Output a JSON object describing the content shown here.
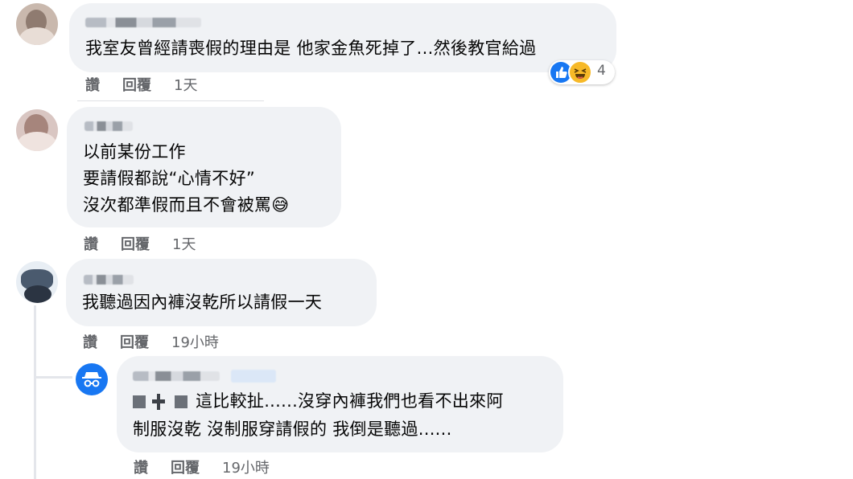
{
  "comments": [
    {
      "text": "我室友曾經請喪假的理由是 他家金魚死掉了...然後教官給過",
      "actions": {
        "like": "讚",
        "reply": "回覆",
        "time": "1天"
      },
      "reaction_count": "4"
    },
    {
      "lines": [
        "以前某份工作",
        "要請假都說“心情不好”",
        "沒次都準假而且不會被罵😅"
      ],
      "actions": {
        "like": "讚",
        "reply": "回覆",
        "time": "1天"
      }
    },
    {
      "text": "我聽過因內褲沒乾所以請假一天",
      "actions": {
        "like": "讚",
        "reply": "回覆",
        "time": "19小時"
      }
    }
  ],
  "reply": {
    "lines": [
      "這比較扯......沒穿內褲我們也看不出來阿",
      "制服沒乾 沒制服穿請假的 我倒是聽過......"
    ],
    "actions": {
      "like": "讚",
      "reply": "回覆",
      "time": "19小時"
    }
  },
  "colors": {
    "bubble": "#f0f2f5",
    "meta": "#65676b",
    "like_blue": "#1877f2",
    "haha_yellow": "#f7b928"
  }
}
